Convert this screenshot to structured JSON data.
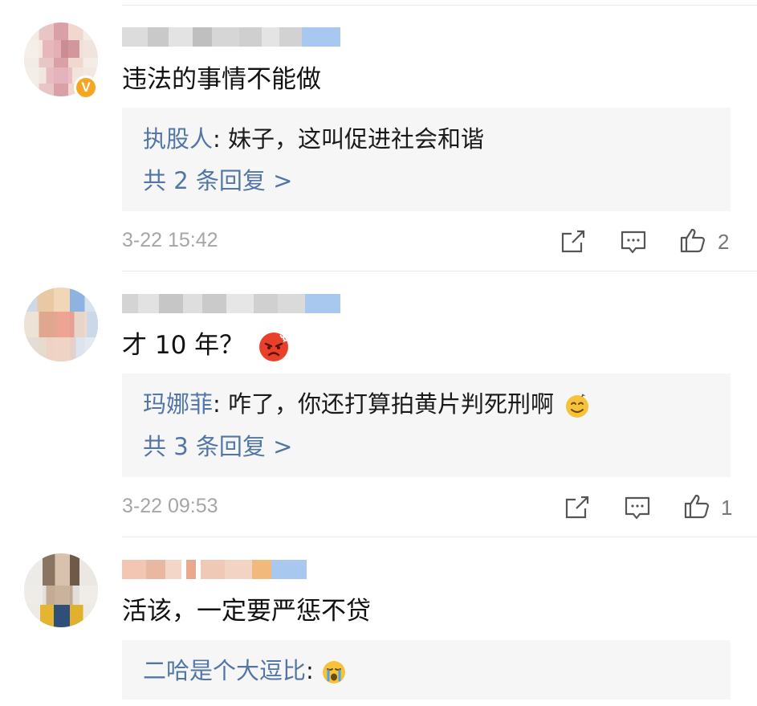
{
  "comments": [
    {
      "text": "违法的事情不能做",
      "verified": true,
      "badge": "V",
      "reply_preview": {
        "author": "执股人",
        "sep": ": ",
        "text": "妹子，这叫促进社会和谐"
      },
      "reply_count_label": "共 2 条回复 >",
      "timestamp": "3-22 15:42",
      "likes": "2"
    },
    {
      "text": "才 10 年？",
      "emoji": "angry-face",
      "reply_preview": {
        "author": "玛娜菲",
        "sep": ": ",
        "text": "咋了，你还打算拍黄片判死刑啊",
        "emoji": "sweat-smile-face"
      },
      "reply_count_label": "共 3 条回复 >",
      "timestamp": "3-22 09:53",
      "likes": "1"
    },
    {
      "text": "活该，一定要严惩不贷",
      "reply_preview": {
        "author": "二哈是个大逗比",
        "sep": ": ",
        "text": "",
        "emoji": "crying-face"
      }
    }
  ],
  "icons": {
    "share": "edit-share-icon",
    "comment": "comment-icon",
    "like": "thumbs-up-icon"
  },
  "colors": {
    "link_blue": "#5276a6",
    "meta_gray": "#a6a6a6",
    "badge_orange": "#f5a623",
    "reply_bg": "#f6f6f6"
  }
}
